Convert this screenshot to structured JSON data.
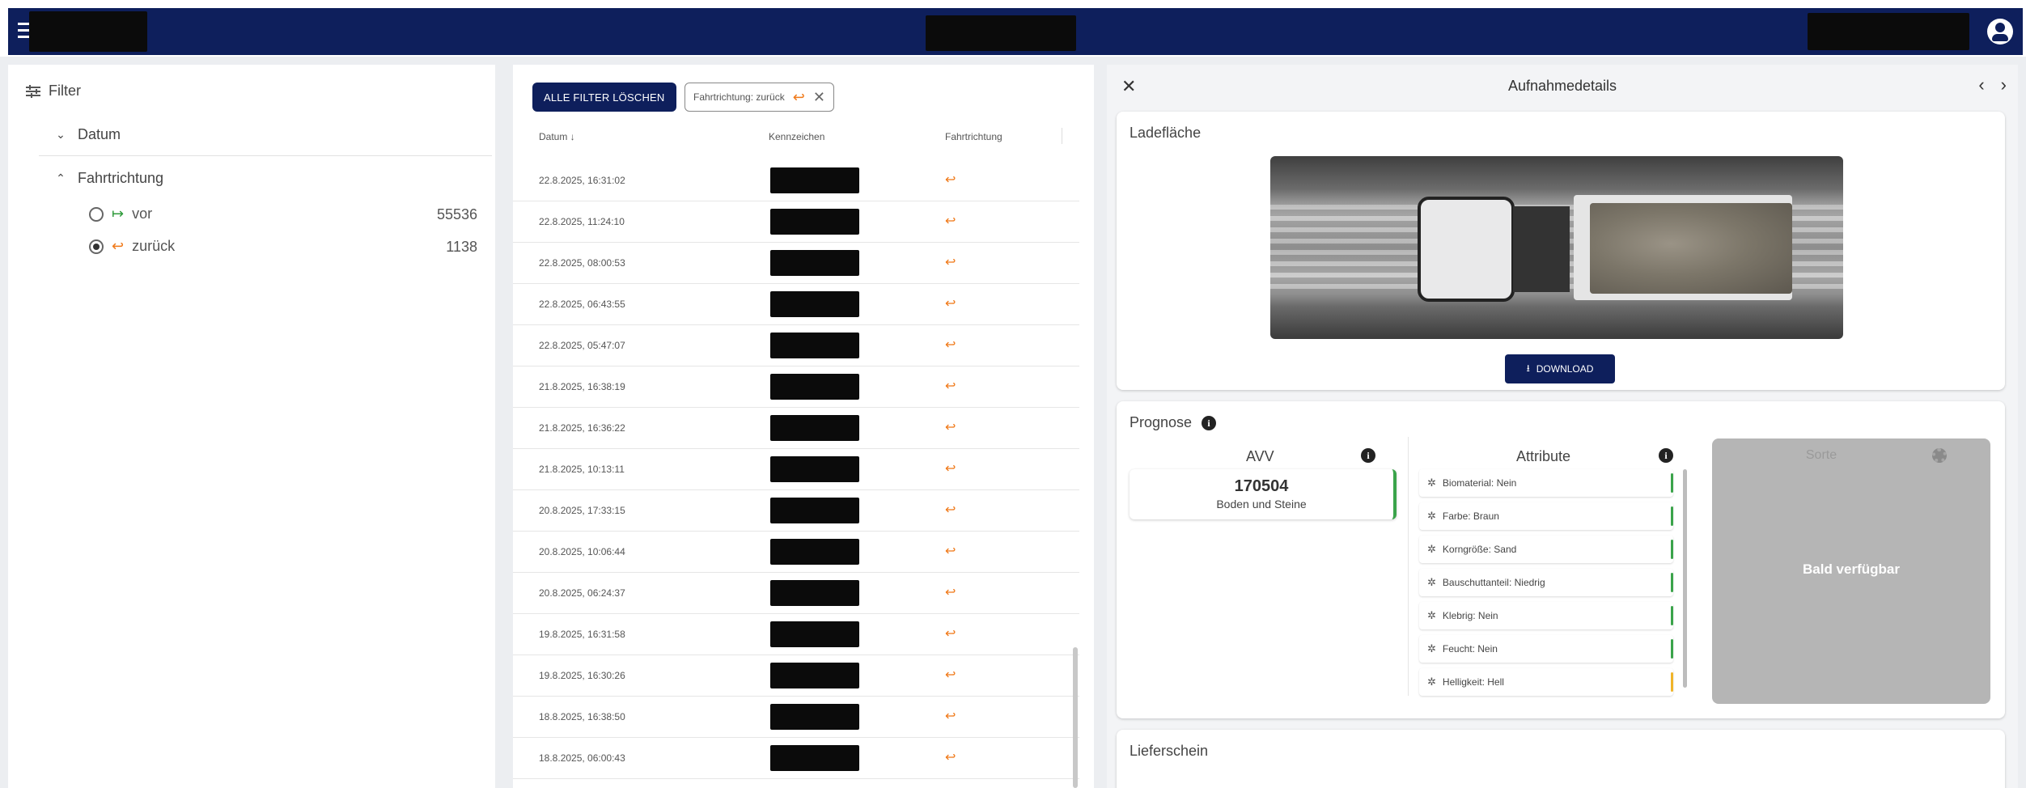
{
  "filters": {
    "title": "Filter",
    "groups": [
      {
        "label": "Datum",
        "expanded": false
      },
      {
        "label": "Fahrtrichtung",
        "expanded": true
      }
    ],
    "options": [
      {
        "label": "vor",
        "arrow": "↦",
        "count": "55536",
        "selected": false
      },
      {
        "label": "zurück",
        "arrow": "↩",
        "count": "1138",
        "selected": true
      }
    ]
  },
  "list": {
    "clear_button": "ALLE FILTER LÖSCHEN",
    "chip_label": "Fahrtrichtung: zurück",
    "chip_arrow": "↩",
    "chip_close": "✕",
    "columns": {
      "date": "Datum ↓",
      "plate": "Kennzeichen",
      "direction": "Fahrtrichtung"
    },
    "direction_arrow": "↩",
    "rows": [
      "22.8.2025, 16:31:02",
      "22.8.2025, 11:24:10",
      "22.8.2025, 08:00:53",
      "22.8.2025, 06:43:55",
      "22.8.2025, 05:47:07",
      "21.8.2025, 16:38:19",
      "21.8.2025, 16:36:22",
      "21.8.2025, 10:13:11",
      "20.8.2025, 17:33:15",
      "20.8.2025, 10:06:44",
      "20.8.2025, 06:24:37",
      "19.8.2025, 16:31:58",
      "19.8.2025, 16:30:26",
      "18.8.2025, 16:38:50",
      "18.8.2025, 06:00:43"
    ]
  },
  "details": {
    "title": "Aufnahmedetails",
    "close": "✕",
    "prev": "‹",
    "next": "›",
    "ladeflaeche": {
      "title": "Ladefläche",
      "download_label": "DOWNLOAD"
    },
    "prognose": {
      "title": "Prognose",
      "avv_label": "AVV",
      "avv_code": "170504",
      "avv_name": "Boden und Steine",
      "attribute_label": "Attribute",
      "attributes": [
        {
          "text": "Biomaterial: Nein",
          "status_color": "#3aa34a"
        },
        {
          "text": "Farbe: Braun",
          "status_color": "#3aa34a"
        },
        {
          "text": "Korngröße: Sand",
          "status_color": "#3aa34a"
        },
        {
          "text": "Bauschuttanteil: Niedrig",
          "status_color": "#3aa34a"
        },
        {
          "text": "Klebrig: Nein",
          "status_color": "#3aa34a"
        },
        {
          "text": "Feucht: Nein",
          "status_color": "#3aa34a"
        },
        {
          "text": "Helligkeit: Hell",
          "status_color": "#f0b429"
        }
      ],
      "sorte_label": "Sorte",
      "sorte_status": "Bald verfügbar"
    },
    "lieferschein": {
      "title": "Lieferschein"
    }
  },
  "colors": {
    "primary": "#0e1f5c",
    "direction_back": "#f07a1a",
    "direction_forward": "#2e9a3a"
  }
}
